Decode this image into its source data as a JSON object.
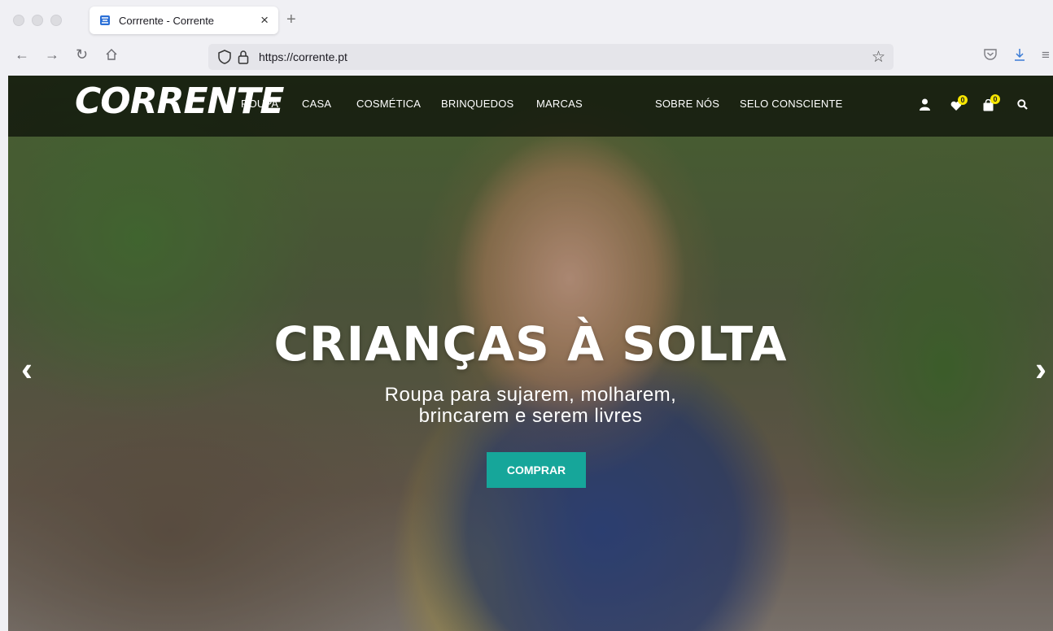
{
  "browser": {
    "tab_title": "Corrrente - Corrente",
    "tab_close": "×",
    "new_tab": "+",
    "url": "https://corrente.pt"
  },
  "site": {
    "logo": "CORRENTE",
    "menu": [
      "ROUPA",
      "CASA",
      "COSMÉTICA",
      "BRINQUEDOS",
      "MARCAS",
      "SOBRE NÓS",
      "SELO CONSCIENTE"
    ],
    "wishlist_count": "0",
    "cart_count": "0"
  },
  "hero": {
    "title": "CRIANÇAS À SOLTA",
    "subtitle": "Roupa para sujarem, molharem, brincarem e serem livres",
    "cta": "COMPRAR"
  },
  "colors": {
    "accent": "#16a69a",
    "badge": "#f7e600"
  }
}
